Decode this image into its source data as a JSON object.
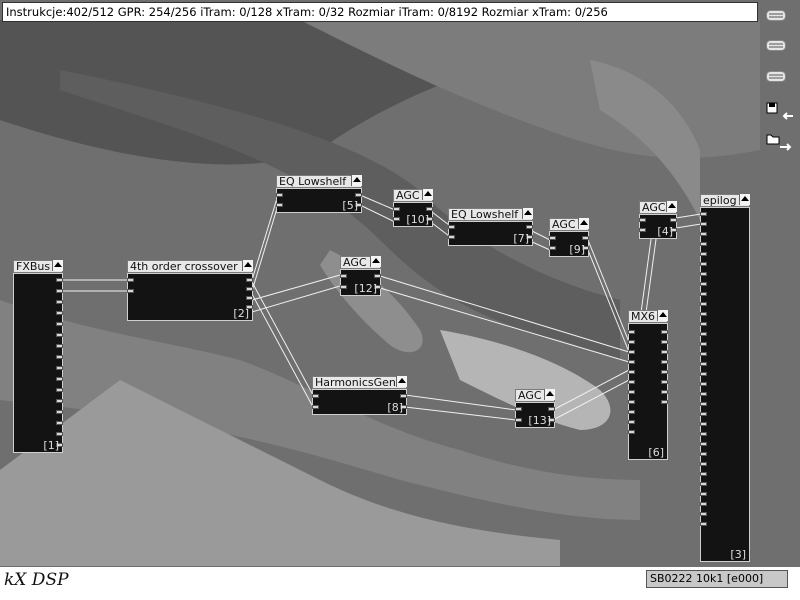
{
  "status_text": "Instrukcje:402/512 GPR: 254/256 iTram: 0/128 xTram: 0/32 Rozmiar iTram: 0/8192 Rozmiar xTram: 0/256",
  "footer": {
    "logo_text": "kX DSP",
    "device_label": "SB0222 10k1 [e000]"
  },
  "toolbar": {
    "icons": [
      "menu-lines-icon",
      "menu-lines-icon",
      "menu-lines-icon",
      "save-arrow-icon",
      "open-arrow-icon"
    ]
  },
  "modules": {
    "fxbus": {
      "title": "FXBus",
      "index": "[1]"
    },
    "crossover": {
      "title": "4th order crossover",
      "index": "[2]"
    },
    "eq_lowshelf_1": {
      "title": "EQ Lowshelf",
      "index": "[5]"
    },
    "agc_10": {
      "title": "AGC",
      "index": "[10]"
    },
    "eq_lowshelf_2": {
      "title": "EQ Lowshelf",
      "index": "[7]"
    },
    "agc_9": {
      "title": "AGC",
      "index": "[9]"
    },
    "agc_4": {
      "title": "AGC",
      "index": "[4]"
    },
    "epilog": {
      "title": "epilog",
      "index": "[3]"
    },
    "agc_12": {
      "title": "AGC",
      "index": "[12]"
    },
    "mx6": {
      "title": "MX6",
      "index": "[6]"
    },
    "harmonicsgen": {
      "title": "HarmonicsGen",
      "index": "[8]"
    },
    "agc_13": {
      "title": "AGC",
      "index": "[13]"
    }
  },
  "colors": {
    "module_body": "#131313",
    "header": "#e8e8e8",
    "wire": "#f0f0f0",
    "desktop": "#6c6c6c"
  }
}
